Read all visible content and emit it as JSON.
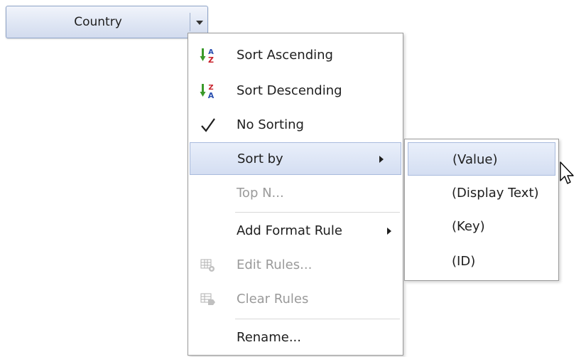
{
  "field_button": {
    "label": "Country",
    "icon": "dropdown-arrow-icon"
  },
  "menu": {
    "items": [
      {
        "label": "Sort Ascending",
        "icon": "sort-ascending-icon",
        "disabled": false
      },
      {
        "label": "Sort Descending",
        "icon": "sort-descending-icon",
        "disabled": false
      },
      {
        "label": "No Sorting",
        "icon": "checkmark-icon",
        "disabled": false,
        "checked": true
      },
      {
        "label": "Sort by",
        "icon": "",
        "disabled": false,
        "submenu": true,
        "highlighted": true
      },
      {
        "label": "Top N...",
        "icon": "",
        "disabled": true
      },
      {
        "label": "Add Format Rule",
        "icon": "",
        "disabled": false,
        "submenu": true
      },
      {
        "label": "Edit Rules...",
        "icon": "edit-rules-icon",
        "disabled": true
      },
      {
        "label": "Clear Rules",
        "icon": "clear-rules-icon",
        "disabled": true
      },
      {
        "label": "Rename...",
        "icon": "",
        "disabled": false
      }
    ]
  },
  "submenu": {
    "items": [
      {
        "label": "(Value)",
        "highlighted": true
      },
      {
        "label": "(Display Text)"
      },
      {
        "label": "(Key)"
      },
      {
        "label": "(ID)"
      }
    ]
  },
  "colors": {
    "highlight": "#d4def2",
    "disabled_text": "#9a9a9a",
    "sort_green": "#3a9a2a",
    "sort_blue": "#2a4fb0",
    "sort_red": "#c8202a"
  }
}
